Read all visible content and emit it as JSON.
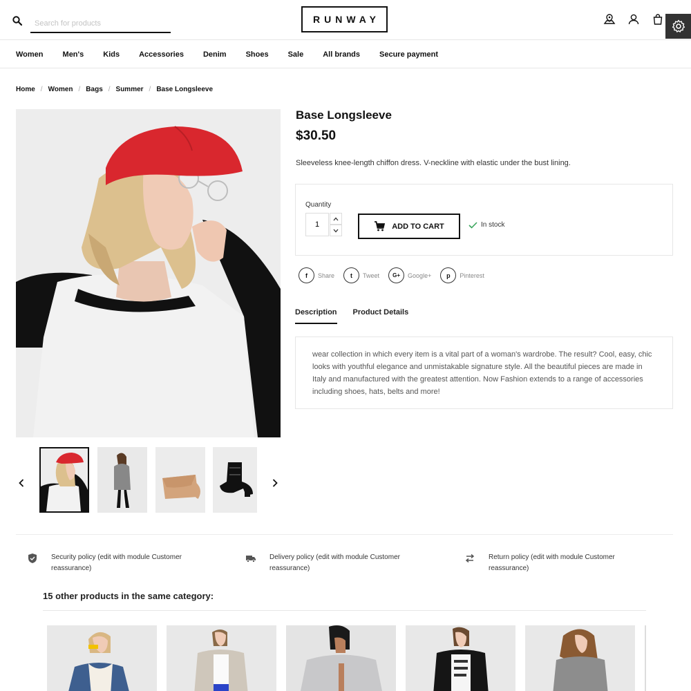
{
  "header": {
    "search_placeholder": "Search for products",
    "logo": "RUNWAY",
    "icons": [
      "search-icon",
      "store-locator-icon",
      "user-icon",
      "cart-icon",
      "gear-icon"
    ]
  },
  "nav": {
    "items": [
      "Women",
      "Men's",
      "Kids",
      "Accessories",
      "Denim",
      "Shoes",
      "Sale",
      "All brands",
      "Secure payment"
    ]
  },
  "breadcrumb": [
    "Home",
    "Women",
    "Bags",
    "Summer",
    "Base Longsleeve"
  ],
  "product": {
    "title": "Base Longsleeve",
    "price": "$30.50",
    "short_description": "Sleeveless knee-length chiffon dress. V-neckline with elastic under the bust lining.",
    "quantity_label": "Quantity",
    "quantity": "1",
    "add_to_cart": "ADD TO CART",
    "stock": "In stock",
    "thumbnails": [
      "model-red-cap",
      "model-grey-jacket",
      "tan-handbag",
      "black-boots"
    ]
  },
  "share": [
    {
      "icon": "f",
      "label": "Share"
    },
    {
      "icon": "t",
      "label": "Tweet"
    },
    {
      "icon": "G+",
      "label": "Google+"
    },
    {
      "icon": "p",
      "label": "Pinterest"
    }
  ],
  "tabs": [
    "Description",
    "Product Details"
  ],
  "description": "wear collection in which every item is a vital part of a woman's wardrobe. The result? Cool, easy, chic looks with youthful elegance and unmistakable signature style. All the beautiful pieces are made in Italy and manufactured with the greatest attention. Now Fashion extends to a range of accessories including shoes, hats, belts and more!",
  "reassurance": [
    {
      "icon": "shield-icon",
      "text": "Security policy (edit with module Customer reassurance)"
    },
    {
      "icon": "truck-icon",
      "text": "Delivery policy (edit with module Customer reassurance)"
    },
    {
      "icon": "swap-arrows-icon",
      "text": "Return policy (edit with module Customer reassurance)"
    }
  ],
  "related": {
    "title": "15 other products in the same category:",
    "cards": 5
  },
  "colors": {
    "text": "#111111",
    "border": "#e6e6e6",
    "stock_check": "#3aa55c",
    "cap": "#d9272e"
  }
}
